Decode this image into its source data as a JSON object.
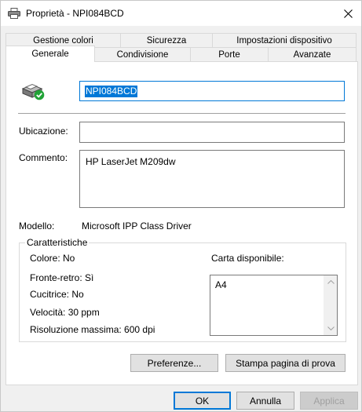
{
  "window": {
    "title": "Proprietà - NPI084BCD"
  },
  "tabs_back": [
    "Gestione colori",
    "Sicurezza",
    "Impostazioni dispositivo"
  ],
  "tabs_front": [
    "Generale",
    "Condivisione",
    "Porte",
    "Avanzate"
  ],
  "printer_name": "NPI084BCD",
  "fields": {
    "location_label": "Ubicazione:",
    "location_value": "",
    "comment_label": "Commento:",
    "comment_value": "HP LaserJet M209dw",
    "model_label": "Modello:",
    "model_value": "Microsoft IPP Class Driver"
  },
  "features": {
    "title": "Caratteristiche",
    "color": "Colore: No",
    "duplex": "Fronte-retro: Sì",
    "stapler": "Cucitrice: No",
    "speed": "Velocità: 30 ppm",
    "resolution": "Risoluzione massima: 600 dpi",
    "paper_label": "Carta disponibile:",
    "paper_items": [
      "A4"
    ]
  },
  "buttons": {
    "preferences": "Preferenze...",
    "print_test": "Stampa pagina di prova",
    "ok": "OK",
    "cancel": "Annulla",
    "apply": "Applica"
  },
  "icons": {
    "title": "printer-icon",
    "close": "close-icon",
    "printer_status": "printer-ready-icon",
    "scroll_up": "chevron-up-icon",
    "scroll_down": "chevron-down-icon"
  },
  "colors": {
    "accent": "#0078d7",
    "ready_green": "#21a336"
  }
}
